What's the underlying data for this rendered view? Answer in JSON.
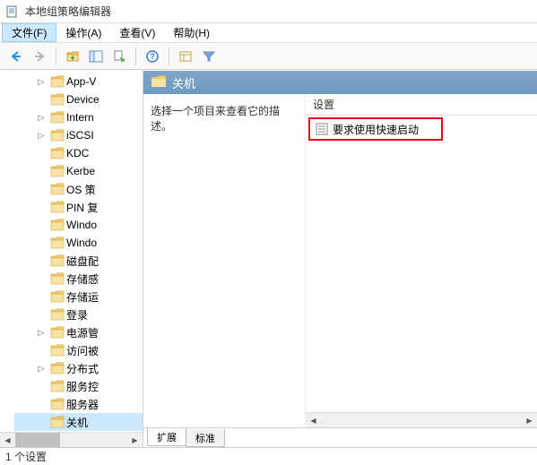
{
  "window": {
    "title": "本地组策略编辑器"
  },
  "menu": {
    "file": "文件(F)",
    "action": "操作(A)",
    "view": "查看(V)",
    "help": "帮助(H)"
  },
  "tree": {
    "items": [
      {
        "label": "App-V",
        "expandable": true
      },
      {
        "label": "Device",
        "expandable": false
      },
      {
        "label": "Intern",
        "expandable": true
      },
      {
        "label": "iSCSI",
        "expandable": true
      },
      {
        "label": "KDC",
        "expandable": false
      },
      {
        "label": "Kerbe",
        "expandable": false
      },
      {
        "label": "OS 策",
        "expandable": false
      },
      {
        "label": "PIN 复",
        "expandable": false
      },
      {
        "label": "Windo",
        "expandable": false
      },
      {
        "label": "Windo",
        "expandable": false
      },
      {
        "label": "磁盘配",
        "expandable": false
      },
      {
        "label": "存储感",
        "expandable": false
      },
      {
        "label": "存储运",
        "expandable": false
      },
      {
        "label": "登录",
        "expandable": false
      },
      {
        "label": "电源管",
        "expandable": true
      },
      {
        "label": "访问被",
        "expandable": false
      },
      {
        "label": "分布式",
        "expandable": true
      },
      {
        "label": "服务控",
        "expandable": false
      },
      {
        "label": "服务器",
        "expandable": false
      },
      {
        "label": "关机",
        "expandable": false,
        "selected": true
      }
    ]
  },
  "detail": {
    "header": "关机",
    "description": "选择一个项目来查看它的描述。",
    "column_header": "设置",
    "items": [
      {
        "label": "要求使用快速启动"
      }
    ]
  },
  "tabs": {
    "extended": "扩展",
    "standard": "标准"
  },
  "status": "1 个设置"
}
